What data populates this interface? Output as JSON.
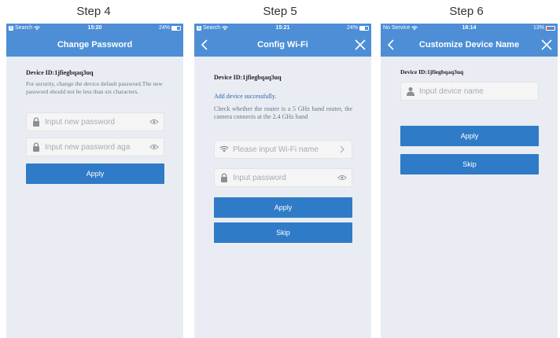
{
  "steps": [
    {
      "label": "Step 4",
      "status": {
        "left": "Search",
        "time": "15:20",
        "battery": "24%"
      },
      "title": "Change Password",
      "device_id": "Device ID:1jfiegbqaq3uq",
      "note": "For security, change the device default password.The new password should not be less than six characters.",
      "password_placeholder": "Input new password",
      "confirm_placeholder": "Input new password aga",
      "apply_label": "Apply"
    },
    {
      "label": "Step 5",
      "status": {
        "left": "Search",
        "time": "15:21",
        "battery": "24%"
      },
      "title": "Config Wi-Fi",
      "device_id": "Device ID:1jfiegbqaq3uq",
      "success": "Add device successfully.",
      "note": "Check whether the router is a 5 GHz band router,   the camera connects at the 2.4 GHz band",
      "wifi_placeholder": "Please input Wi-Fi name",
      "password_placeholder": "Input password",
      "apply_label": "Apply",
      "skip_label": "Skip"
    },
    {
      "label": "Step 6",
      "status": {
        "left": "No Service",
        "time": "16:14",
        "battery": "13%"
      },
      "title": "Customize Device Name",
      "device_id": "Device ID:1jfiegbqaq3uq",
      "name_placeholder": "Input device name",
      "apply_label": "Apply",
      "skip_label": "Skip"
    }
  ],
  "colors": {
    "header": "#4d8ed6",
    "button": "#2f7bc7",
    "background": "#e9edf3",
    "success_text": "#2c63a8"
  },
  "icons": [
    "wifi-icon",
    "battery-icon",
    "lock-icon",
    "eye-icon",
    "back-chevron-icon",
    "close-icon",
    "user-icon",
    "chevron-right-icon"
  ]
}
